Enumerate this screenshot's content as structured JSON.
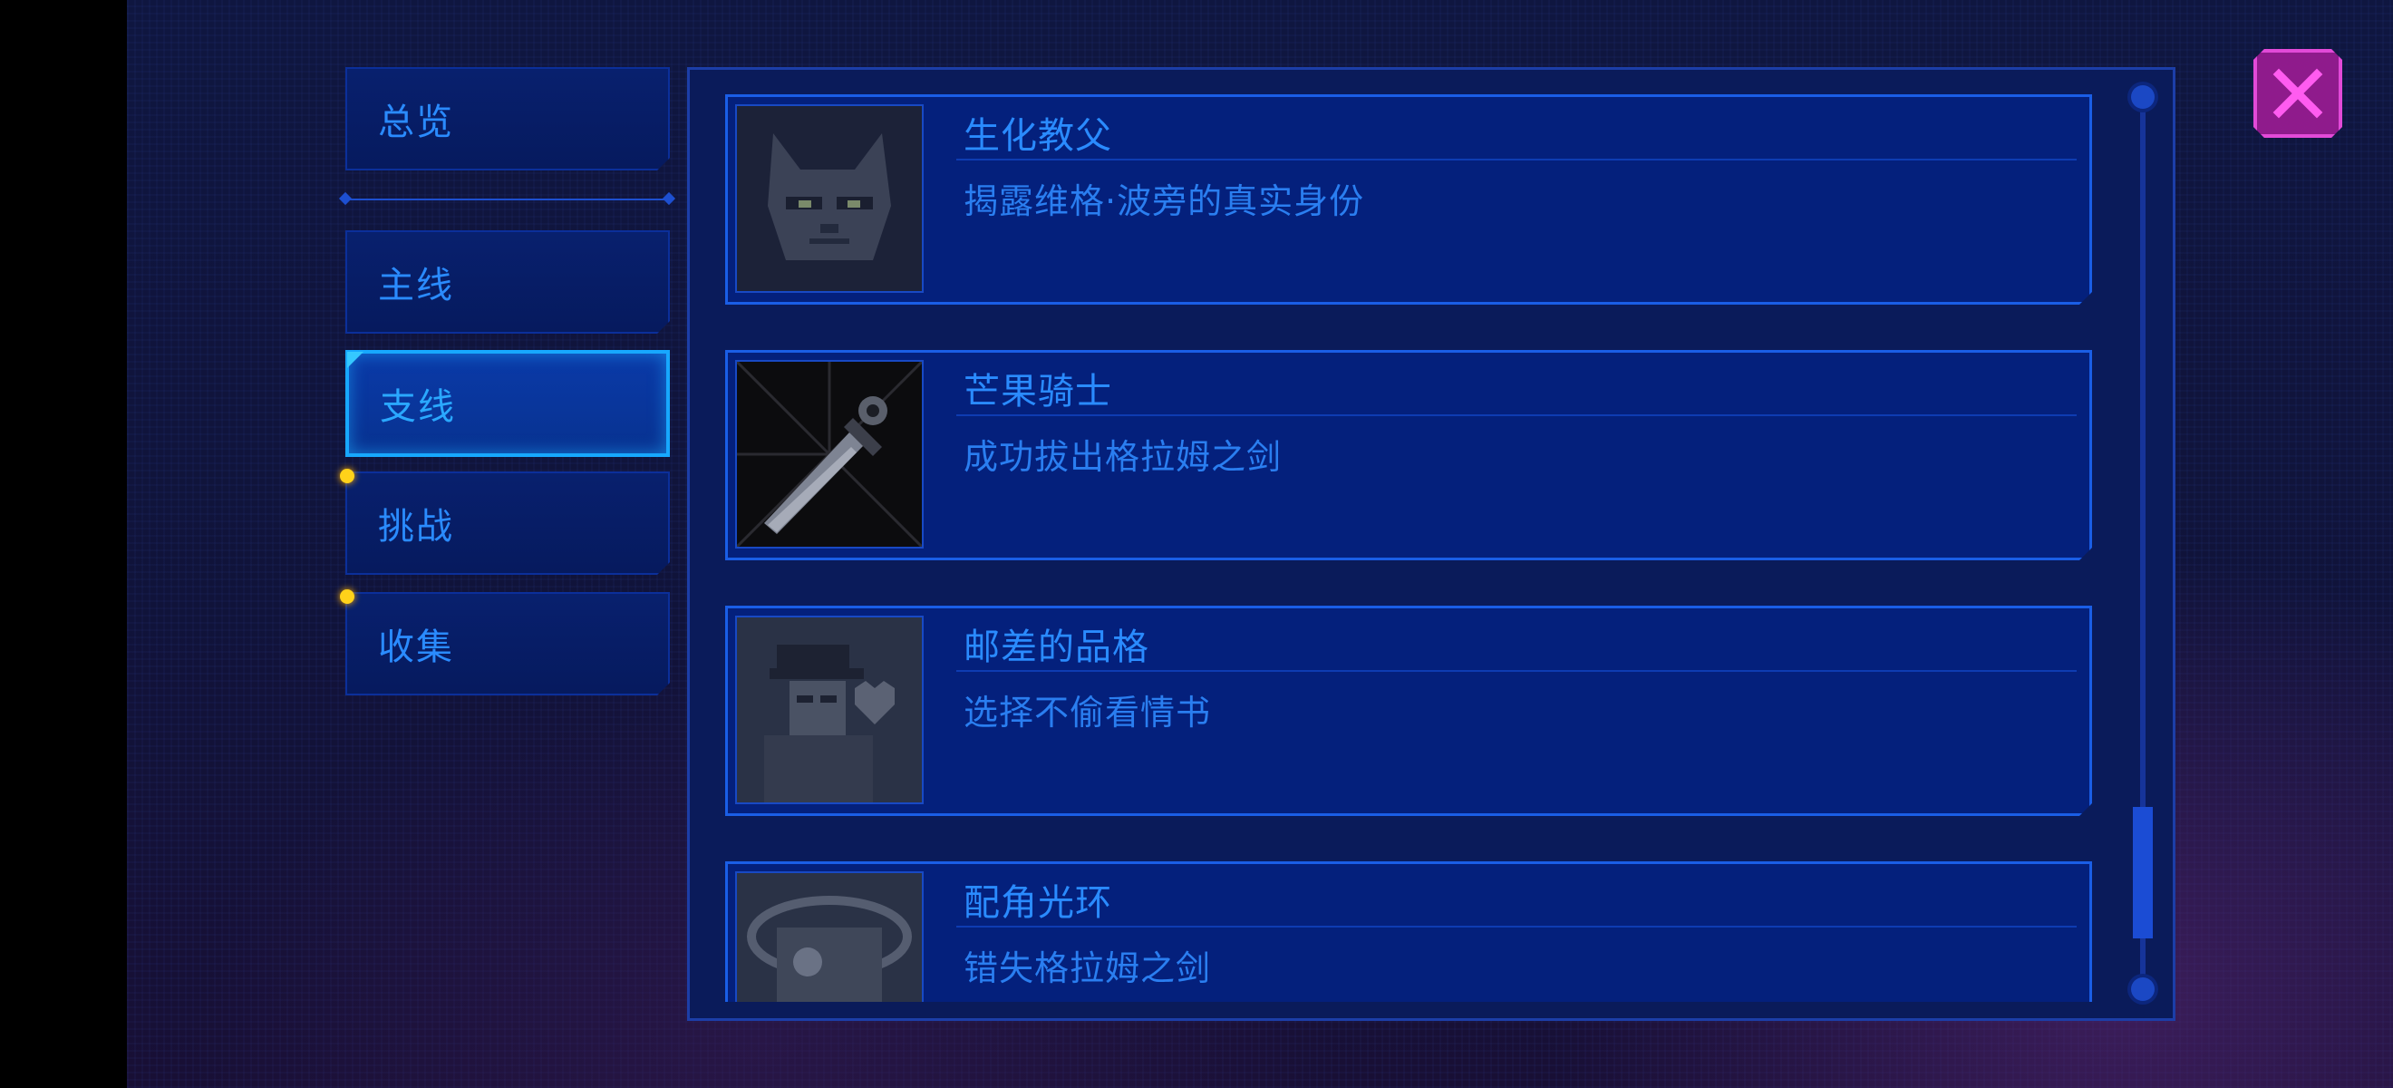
{
  "sidebar": {
    "tabs": [
      {
        "label": "总览"
      },
      {
        "label": "主线"
      },
      {
        "label": "支线"
      },
      {
        "label": "挑战"
      },
      {
        "label": "收集"
      }
    ]
  },
  "achievements": [
    {
      "title": "生化教父",
      "description": "揭露维格·波旁的真实身份",
      "icon": "cat-portrait-icon"
    },
    {
      "title": "芒果骑士",
      "description": "成功拔出格拉姆之剑",
      "icon": "sword-icon"
    },
    {
      "title": "邮差的品格",
      "description": "选择不偷看情书",
      "icon": "postman-heart-icon"
    },
    {
      "title": "配角光环",
      "description": "错失格拉姆之剑",
      "icon": "halo-character-icon"
    }
  ],
  "colors": {
    "accent": "#2a8bff",
    "panel": "#04207c",
    "notification": "#ffd21a",
    "close": "#e24ad8"
  }
}
